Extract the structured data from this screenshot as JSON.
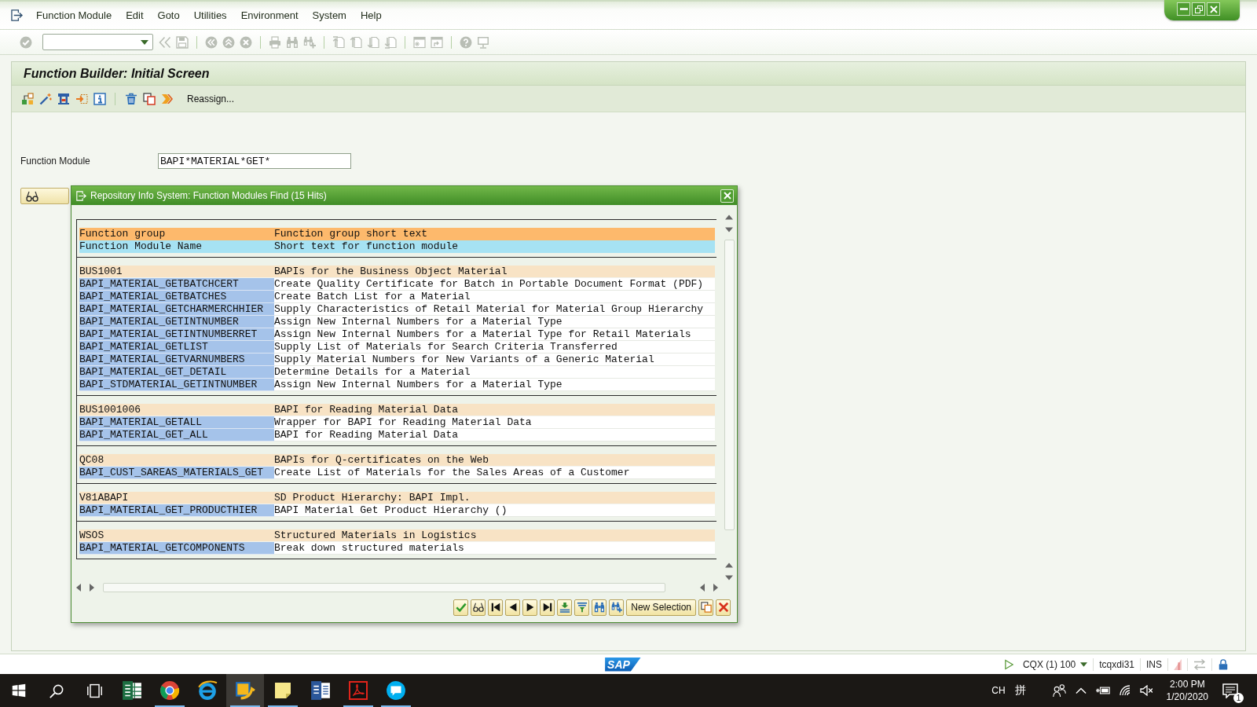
{
  "menu_bar": {
    "items": [
      "Function Module",
      "Edit",
      "Goto",
      "Utilities",
      "Environment",
      "System",
      "Help"
    ]
  },
  "standard_toolbar": {
    "groups": [
      [
        {
          "kind": "enter",
          "disabled": true
        }
      ],
      [
        {
          "kind": "collapse",
          "disabled": true
        },
        {
          "kind": "save",
          "disabled": true
        }
      ],
      [
        {
          "kind": "back",
          "disabled": true
        },
        {
          "kind": "exit",
          "disabled": true
        },
        {
          "kind": "cancel",
          "disabled": true
        }
      ],
      [
        {
          "kind": "print",
          "disabled": true
        },
        {
          "kind": "find",
          "disabled": true
        },
        {
          "kind": "find_next",
          "disabled": true
        }
      ],
      [
        {
          "kind": "first_page",
          "disabled": true
        },
        {
          "kind": "prev_page",
          "disabled": true
        },
        {
          "kind": "next_page",
          "disabled": true
        },
        {
          "kind": "last_page",
          "disabled": true
        }
      ],
      [
        {
          "kind": "new_session",
          "disabled": true
        },
        {
          "kind": "shortcut",
          "disabled": true
        }
      ],
      [
        {
          "kind": "help",
          "disabled": true
        },
        {
          "kind": "layout",
          "disabled": true
        }
      ]
    ]
  },
  "screen": {
    "title": "Function Builder: Initial Screen",
    "toolbar": {
      "groups": [
        [
          {
            "kind": "hierarchy"
          },
          {
            "kind": "wand"
          },
          {
            "kind": "clamp"
          },
          {
            "kind": "export"
          },
          {
            "kind": "info"
          }
        ],
        [
          {
            "kind": "trash"
          },
          {
            "kind": "copy"
          },
          {
            "kind": "rename"
          },
          {
            "kind": "reassign",
            "label": "Reassign..."
          }
        ]
      ]
    },
    "fields": [
      {
        "label": "Function Module",
        "value": "BAPI*MATERIAL*GET*"
      }
    ],
    "buttons": [
      {
        "kind": "display"
      }
    ]
  },
  "dialog": {
    "title": "Repository Info System: Function Modules Find (15 Hits)",
    "legend": [
      {
        "kind": "group",
        "name": "Function group",
        "text": "Function group short text"
      },
      {
        "kind": "module",
        "name": "Function Module Name",
        "text": "Short text for function module"
      }
    ],
    "groups": [
      {
        "name": "BUS1001",
        "text": "BAPIs for the Business Object Material",
        "modules": [
          {
            "name": "BAPI_MATERIAL_GETBATCHCERT",
            "text": "Create Quality Certificate for Batch in Portable Document Format (PDF)"
          },
          {
            "name": "BAPI_MATERIAL_GETBATCHES",
            "text": "Create Batch List for a Material"
          },
          {
            "name": "BAPI_MATERIAL_GETCHARMERCHHIER",
            "text": "Supply Characteristics of Retail Material for Material Group Hierarchy"
          },
          {
            "name": "BAPI_MATERIAL_GETINTNUMBER",
            "text": "Assign New Internal Numbers for a Material Type"
          },
          {
            "name": "BAPI_MATERIAL_GETINTNUMBERRET",
            "text": "Assign New Internal Numbers for a Material Type for Retail Materials"
          },
          {
            "name": "BAPI_MATERIAL_GETLIST",
            "text": "Supply List of Materials for Search Criteria Transferred"
          },
          {
            "name": "BAPI_MATERIAL_GETVARNUMBERS",
            "text": "Supply Material Numbers for New Variants of a Generic Material"
          },
          {
            "name": "BAPI_MATERIAL_GET_DETAIL",
            "text": "Determine Details for a Material"
          },
          {
            "name": "BAPI_STDMATERIAL_GETINTNUMBER",
            "text": "Assign New Internal Numbers for a Material Type"
          }
        ]
      },
      {
        "name": "BUS1001006",
        "text": "BAPI for Reading Material Data",
        "modules": [
          {
            "name": "BAPI_MATERIAL_GETALL",
            "text": "Wrapper for BAPI for Reading Material Data"
          },
          {
            "name": "BAPI_MATERIAL_GET_ALL",
            "text": "BAPI for Reading Material Data"
          }
        ]
      },
      {
        "name": "QC08",
        "text": "BAPIs for Q-certificates on the Web",
        "modules": [
          {
            "name": "BAPI_CUST_SAREAS_MATERIALS_GET",
            "text": "Create List of Materials for the Sales Areas of a Customer"
          }
        ]
      },
      {
        "name": "V81ABAPI",
        "text": "SD Product Hierarchy: BAPI Impl.",
        "modules": [
          {
            "name": "BAPI_MATERIAL_GET_PRODUCTHIER",
            "text": "BAPI Material Get Product Hierarchy ()"
          }
        ]
      },
      {
        "name": "WSOS",
        "text": "Structured Materials in Logistics",
        "modules": [
          {
            "name": "BAPI_MATERIAL_GETCOMPONENTS",
            "text": "Break down structured materials"
          }
        ]
      }
    ],
    "buttons": [
      {
        "kind": "confirm"
      },
      {
        "kind": "display"
      },
      {
        "kind": "first"
      },
      {
        "kind": "previous"
      },
      {
        "kind": "next"
      },
      {
        "kind": "last"
      },
      {
        "kind": "sort"
      },
      {
        "kind": "filter"
      },
      {
        "kind": "find"
      },
      {
        "kind": "find_next"
      },
      {
        "kind": "new_selection",
        "label": "New Selection"
      },
      {
        "kind": "copy_window"
      },
      {
        "kind": "cancel"
      }
    ]
  },
  "status_bar": {
    "logo": "SAP",
    "system": "CQX (1) 100",
    "user": "tcqxdi31",
    "mode": "INS"
  },
  "taskbar": {
    "buttons": [
      {
        "kind": "start"
      },
      {
        "kind": "search"
      },
      {
        "kind": "task_view"
      }
    ],
    "apps": [
      {
        "kind": "spreadsheet",
        "running": false,
        "selected": false
      },
      {
        "kind": "browser",
        "running": true,
        "selected": false
      },
      {
        "kind": "web_browser",
        "running": false,
        "selected": false
      },
      {
        "kind": "logon",
        "running": true,
        "selected": true
      },
      {
        "kind": "note",
        "running": true,
        "selected": false
      },
      {
        "kind": "document",
        "running": false,
        "selected": false
      },
      {
        "kind": "pdf",
        "running": true,
        "selected": false
      },
      {
        "kind": "chat",
        "running": true,
        "selected": false
      }
    ],
    "language": "CH",
    "ime": "拼",
    "time": "2:00 PM",
    "date": "1/20/2020",
    "notifications": "1"
  }
}
